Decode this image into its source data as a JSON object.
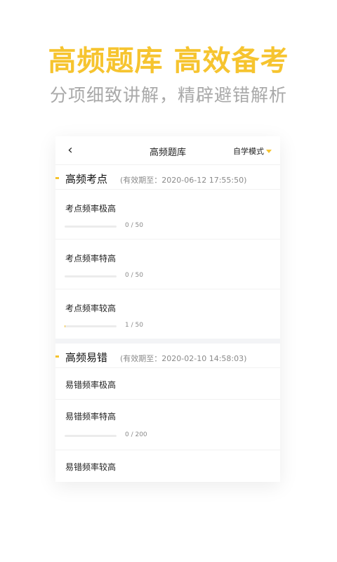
{
  "promo": {
    "headline": "高频题库 高效备考",
    "subline": "分项细致讲解，精辟避错解析"
  },
  "navbar": {
    "back_glyph": "‹",
    "title": "高频题库",
    "mode_label": "自学模式"
  },
  "sections": [
    {
      "title": "高频考点",
      "expiry": "(有效期至：2020-06-12 17:55:50)",
      "items": [
        {
          "label": "考点频率极高",
          "done": 0,
          "total": 50,
          "count_text": "0 / 50"
        },
        {
          "label": "考点频率特高",
          "done": 0,
          "total": 50,
          "count_text": "0 / 50"
        },
        {
          "label": "考点频率较高",
          "done": 1,
          "total": 50,
          "count_text": "1 / 50"
        }
      ]
    },
    {
      "title": "高频易错",
      "expiry": "(有效期至：2020-02-10 14:58:03)",
      "items": [
        {
          "label": "易错频率极高"
        },
        {
          "label": "易错频率特高",
          "done": 0,
          "total": 200,
          "count_text": "0 / 200"
        },
        {
          "label": "易错频率较高"
        }
      ]
    }
  ],
  "colors": {
    "accent": "#f6c42f",
    "subline": "#a9a9a9"
  }
}
